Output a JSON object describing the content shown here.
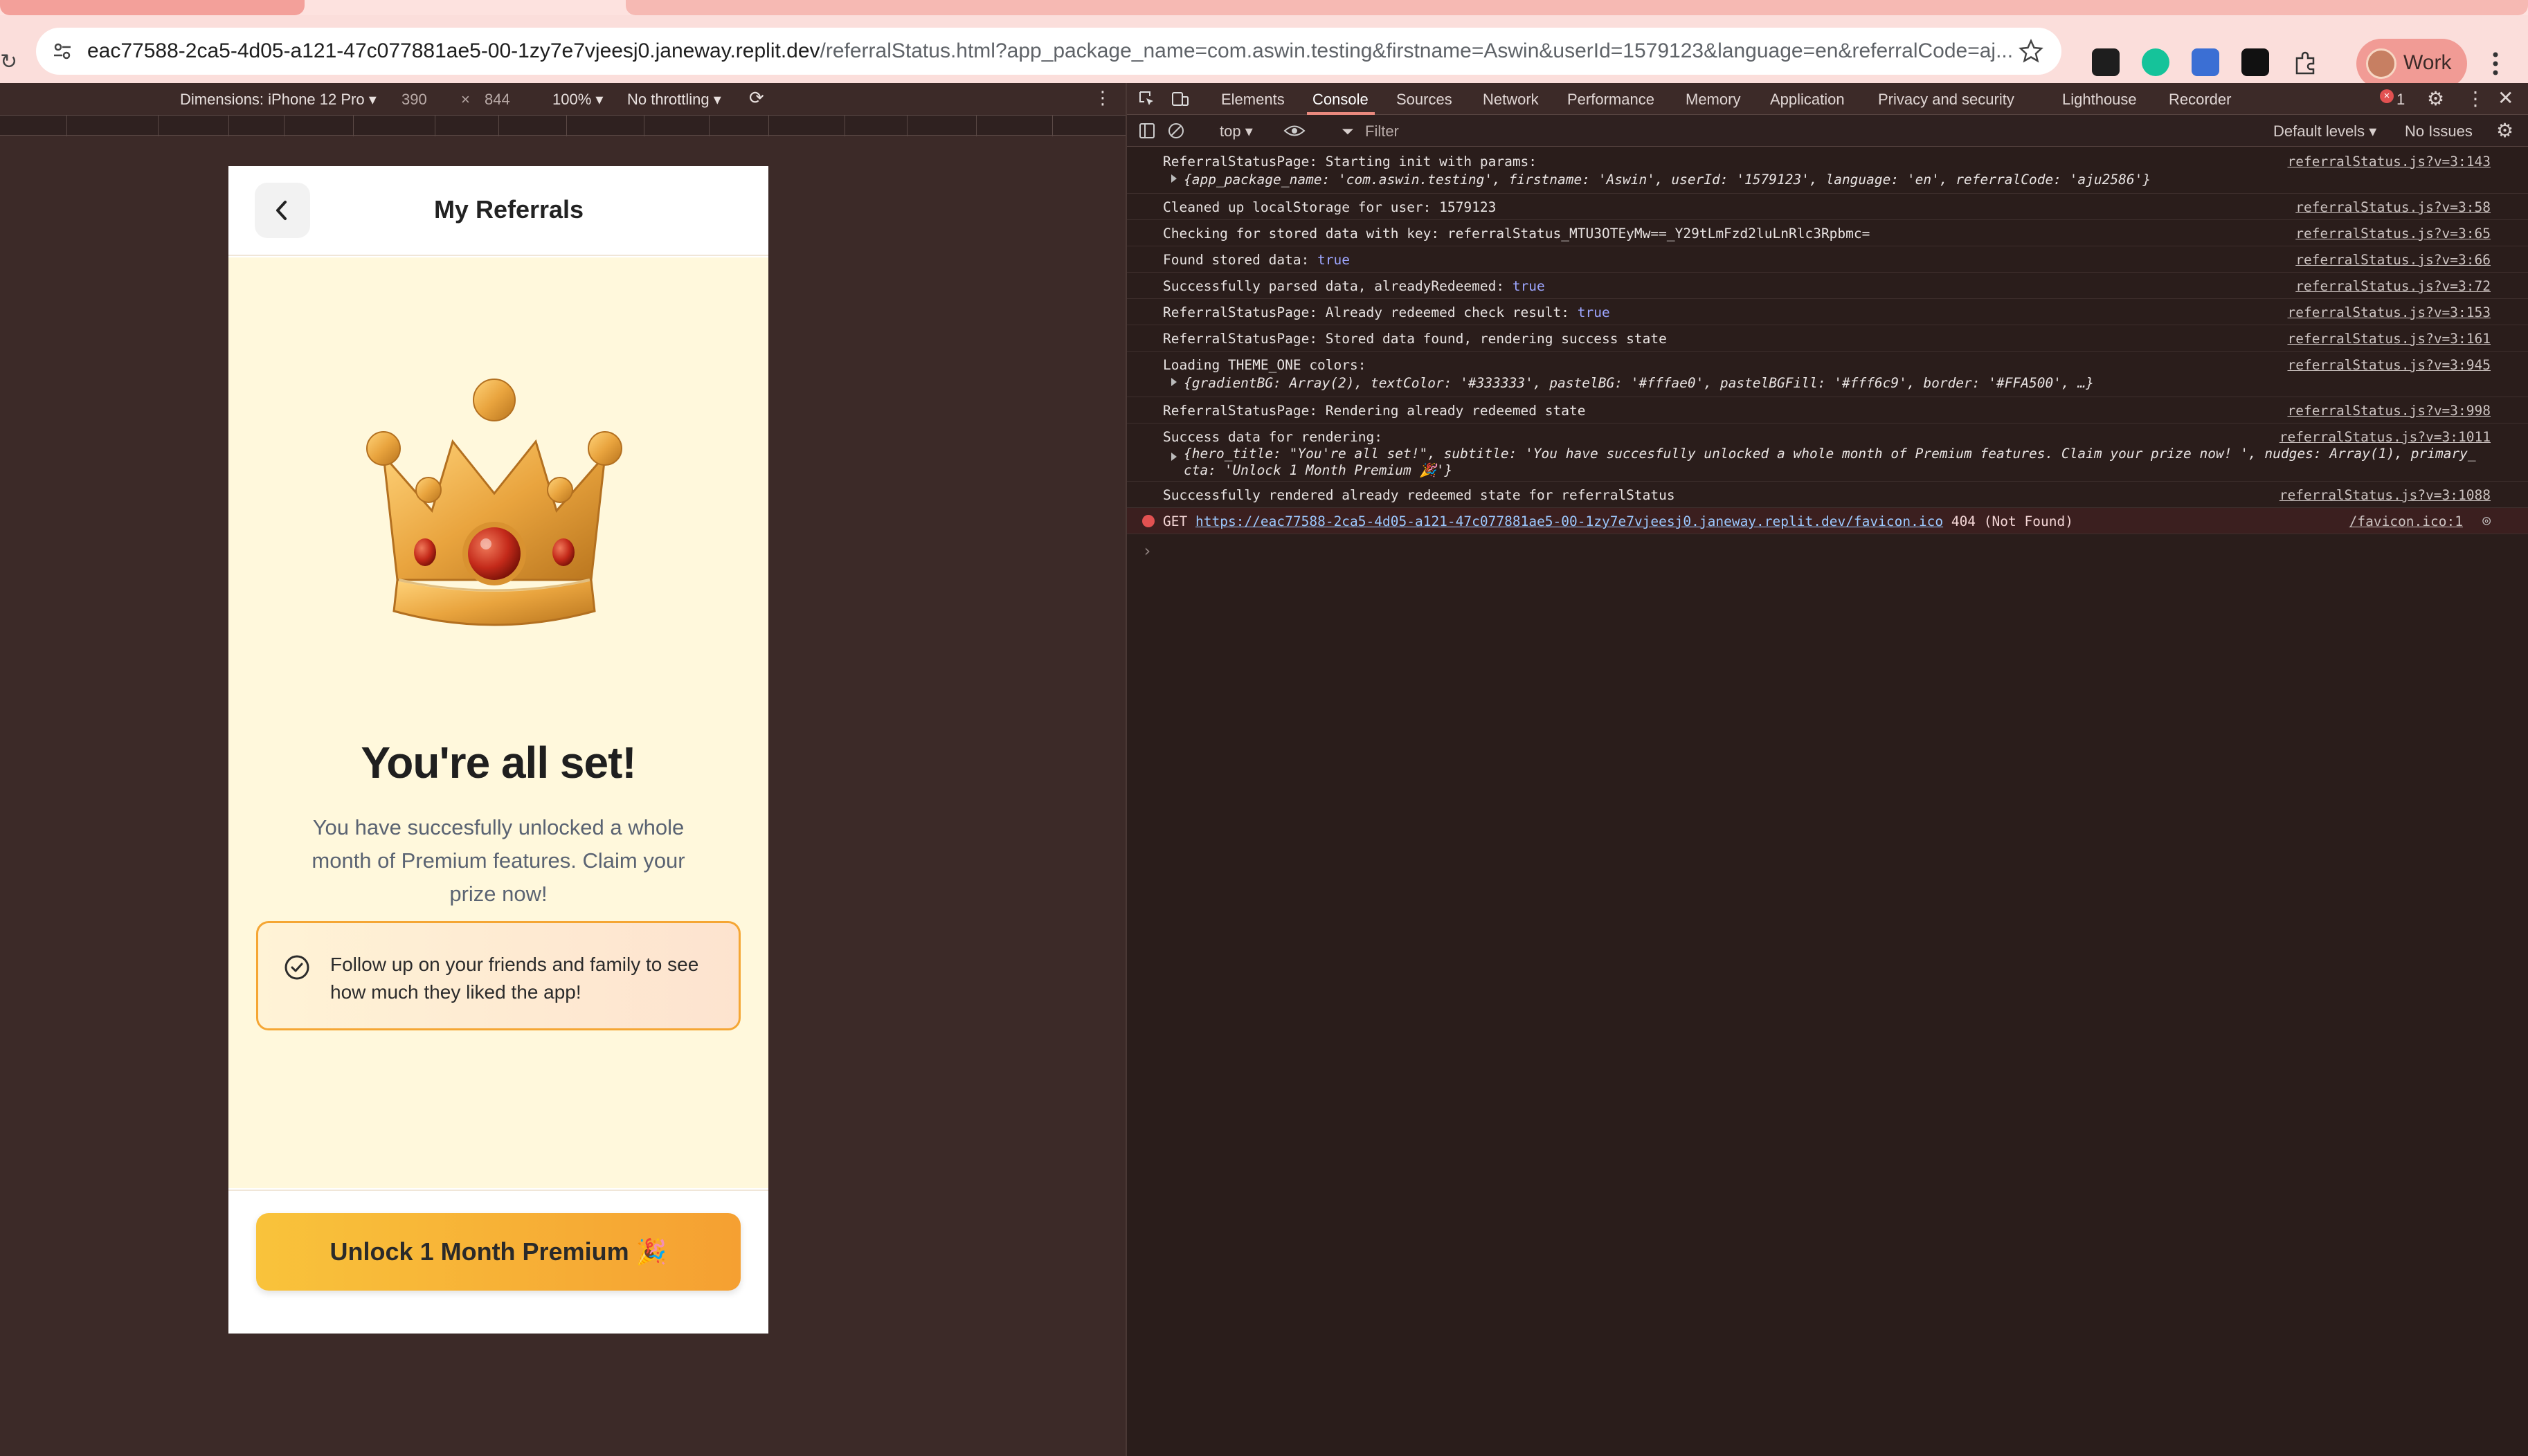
{
  "browser": {
    "url_host": "eac77588-2ca5-4d05-a121-47c077881ae5-00-1zy7e7vjeesj0.janeway.replit.dev",
    "url_path": "/referralStatus.html?app_package_name=com.aswin.testing&firstname=Aswin&userId=1579123&language=en&referralCode=aj...",
    "profile_label": "Work"
  },
  "device_toolbar": {
    "dimensions_label": "Dimensions: iPhone 12 Pro",
    "width": "390",
    "times": "×",
    "height": "844",
    "zoom": "100%",
    "throttling": "No throttling"
  },
  "phone": {
    "header_title": "My Referrals",
    "hero_title": "You're all set!",
    "subtitle": "You have succesfully unlocked a whole month of Premium features. Claim your prize now!",
    "nudge_text": "Follow up on your friends and family to see how much they liked the app!",
    "cta_label": "Unlock 1 Month Premium 🎉"
  },
  "devtools": {
    "tabs": [
      "Elements",
      "Console",
      "Sources",
      "Network",
      "Performance",
      "Memory",
      "Application",
      "Privacy and security",
      "Lighthouse",
      "Recorder"
    ],
    "active_tab": "Console",
    "error_count": "1",
    "context": "top",
    "filter_placeholder": "Filter",
    "levels": "Default levels",
    "issues": "No Issues",
    "logs": [
      {
        "text": "ReferralStatusPage: Starting init with params:",
        "source": "referralStatus.js?v=3:143"
      },
      {
        "text": "Cleaned up localStorage for user: 1579123",
        "source": "referralStatus.js?v=3:58"
      },
      {
        "text": "Checking for stored data with key: referralStatus_MTU3OTEyMw==_Y29tLmFzd2luLnRlc3Rpbmc=",
        "source": "referralStatus.js?v=3:65"
      },
      {
        "text": "Found stored data: ",
        "value": "true",
        "source": "referralStatus.js?v=3:66"
      },
      {
        "text": "Successfully parsed data, alreadyRedeemed: ",
        "value": "true",
        "source": "referralStatus.js?v=3:72"
      },
      {
        "text": "ReferralStatusPage: Already redeemed check result: ",
        "value": "true",
        "source": "referralStatus.js?v=3:153"
      },
      {
        "text": "ReferralStatusPage: Stored data found, rendering success state",
        "source": "referralStatus.js?v=3:161"
      },
      {
        "text": "Loading THEME_ONE colors:",
        "source": "referralStatus.js?v=3:945"
      },
      {
        "text": "ReferralStatusPage: Rendering already redeemed state",
        "source": "referralStatus.js?v=3:998"
      },
      {
        "text": "Success data for rendering:",
        "source": "referralStatus.js?v=3:1011"
      },
      {
        "text": "Successfully rendered already redeemed state for referralStatus",
        "source": "referralStatus.js?v=3:1088"
      }
    ],
    "params_obj": "{app_package_name: 'com.aswin.testing', firstname: 'Aswin', userId: '1579123', language: 'en', referralCode: 'aju2586'}",
    "theme_obj": "{gradientBG: Array(2), textColor: '#333333', pastelBG: '#fffae0', pastelBGFill: '#fff6c9', border: '#FFA500', …}",
    "success_obj_line1": "{hero_title: \"You're all set!\", subtitle: 'You have succesfully unlocked a whole month of Premium features. Claim your prize now! ', nudges: Array(1), primary_",
    "success_obj_line2": "cta: 'Unlock 1 Month Premium 🎉'}",
    "error": {
      "method": "GET",
      "url": "https://eac77588-2ca5-4d05-a121-47c077881ae5-00-1zy7e7vjeesj0.janeway.replit.dev/favicon.ico",
      "status": "404 (Not Found)",
      "source": "/favicon.ico:1"
    },
    "prompt": "›"
  },
  "colors": {
    "accent": "#f5a032",
    "pastel_bg": "#fff8dc",
    "devtools_bg": "#2a1d1b",
    "viewport_bg": "#3c2a28"
  }
}
